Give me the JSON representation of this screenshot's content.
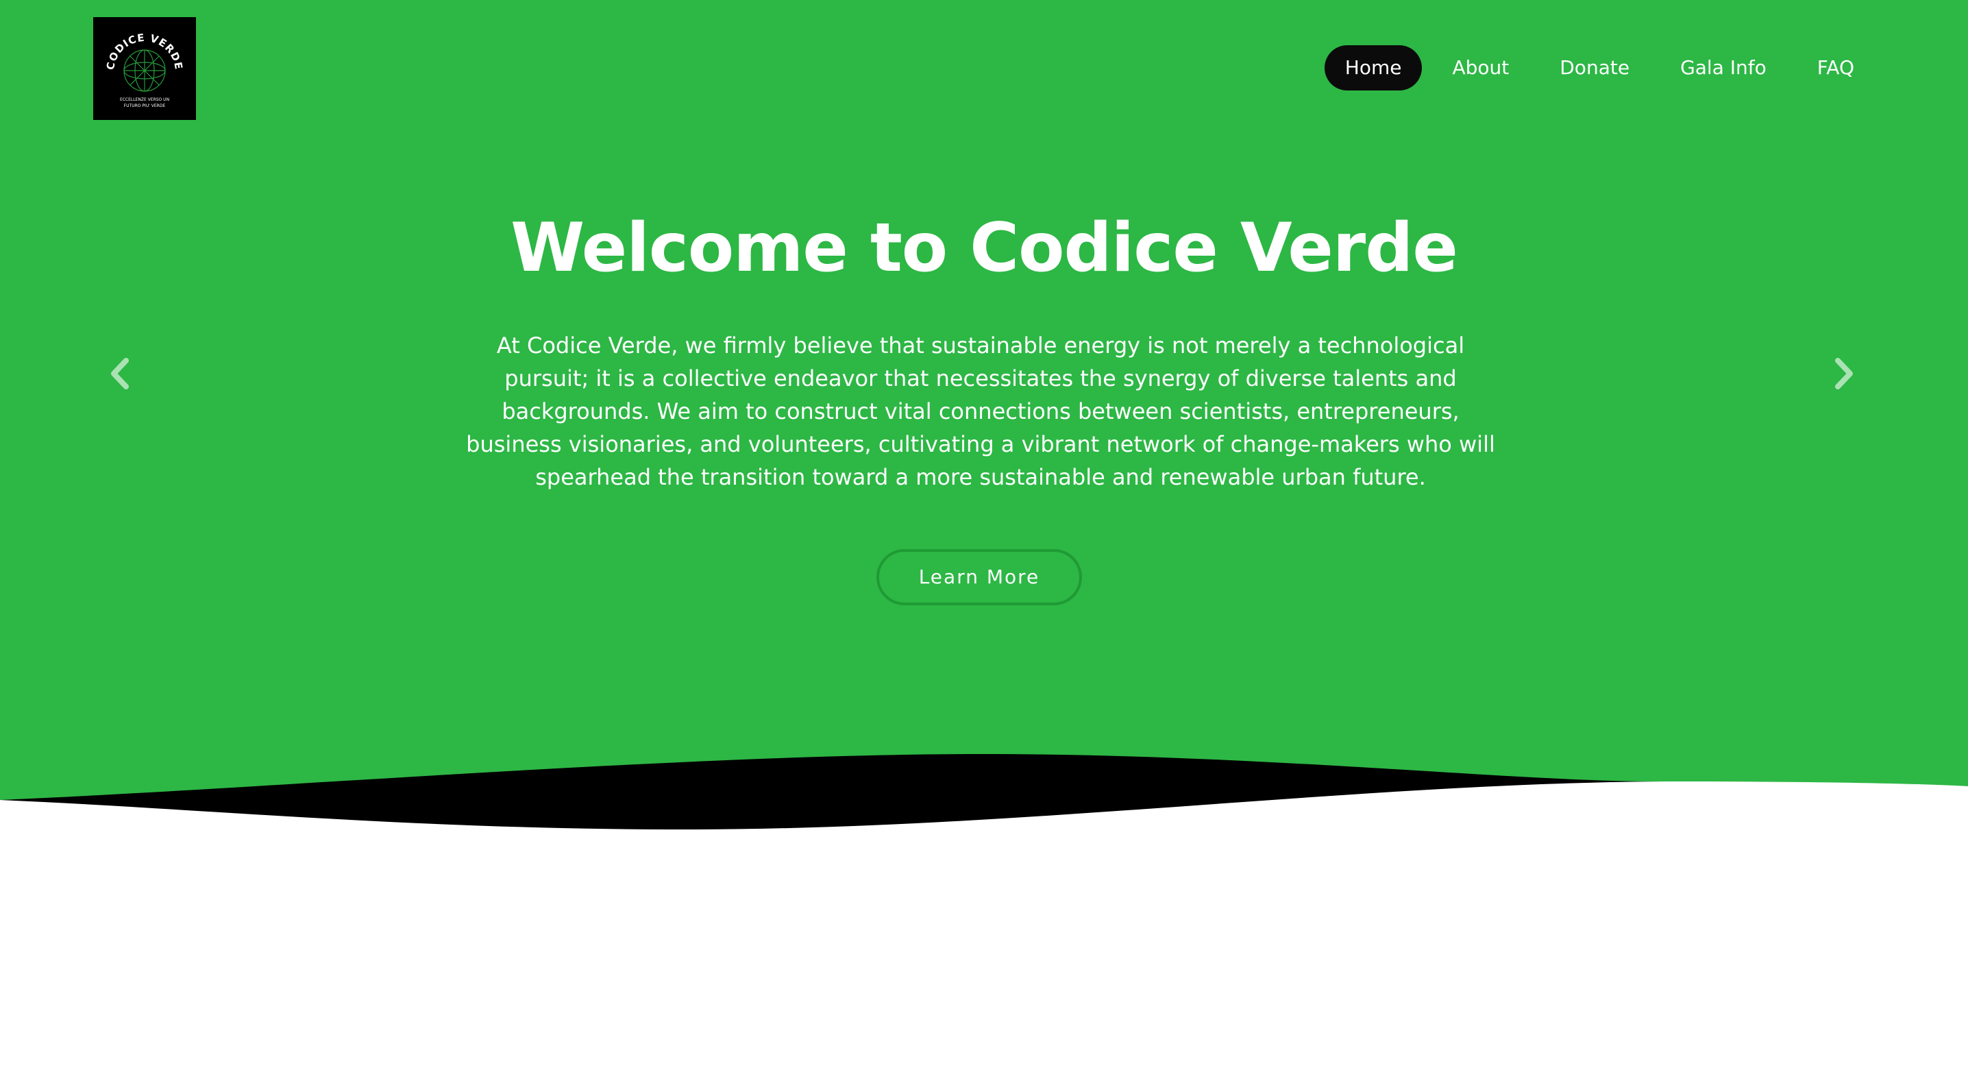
{
  "brand": {
    "logo_title": "CODICE VERDE",
    "logo_tagline_line1": "ECCELLENZE VERSO UN",
    "logo_tagline_line2": "FUTURO PIU' VERDE"
  },
  "nav": {
    "items": [
      {
        "label": "Home",
        "active": true
      },
      {
        "label": "About",
        "active": false
      },
      {
        "label": "Donate",
        "active": false
      },
      {
        "label": "Gala Info",
        "active": false
      },
      {
        "label": "FAQ",
        "active": false
      }
    ]
  },
  "hero": {
    "title": "Welcome to Codice Verde",
    "text": "At Codice Verde, we firmly believe that sustainable energy is not merely a technological pursuit; it is a collective endeavor that necessitates the synergy of diverse talents and backgrounds. We aim to construct vital connections between scientists, entrepreneurs, business visionaries, and volunteers, cultivating a vibrant network of change-makers who will spearhead the transition toward a more sustainable and renewable urban future.",
    "button_label": "Learn More"
  },
  "icons": {
    "prev": "chevron-left-icon",
    "next": "chevron-right-icon"
  },
  "colors": {
    "hero_bg": "#2db745",
    "active_nav_bg": "#0b0b0b",
    "wave_dark": "#000000",
    "page_bg": "#ffffff"
  }
}
